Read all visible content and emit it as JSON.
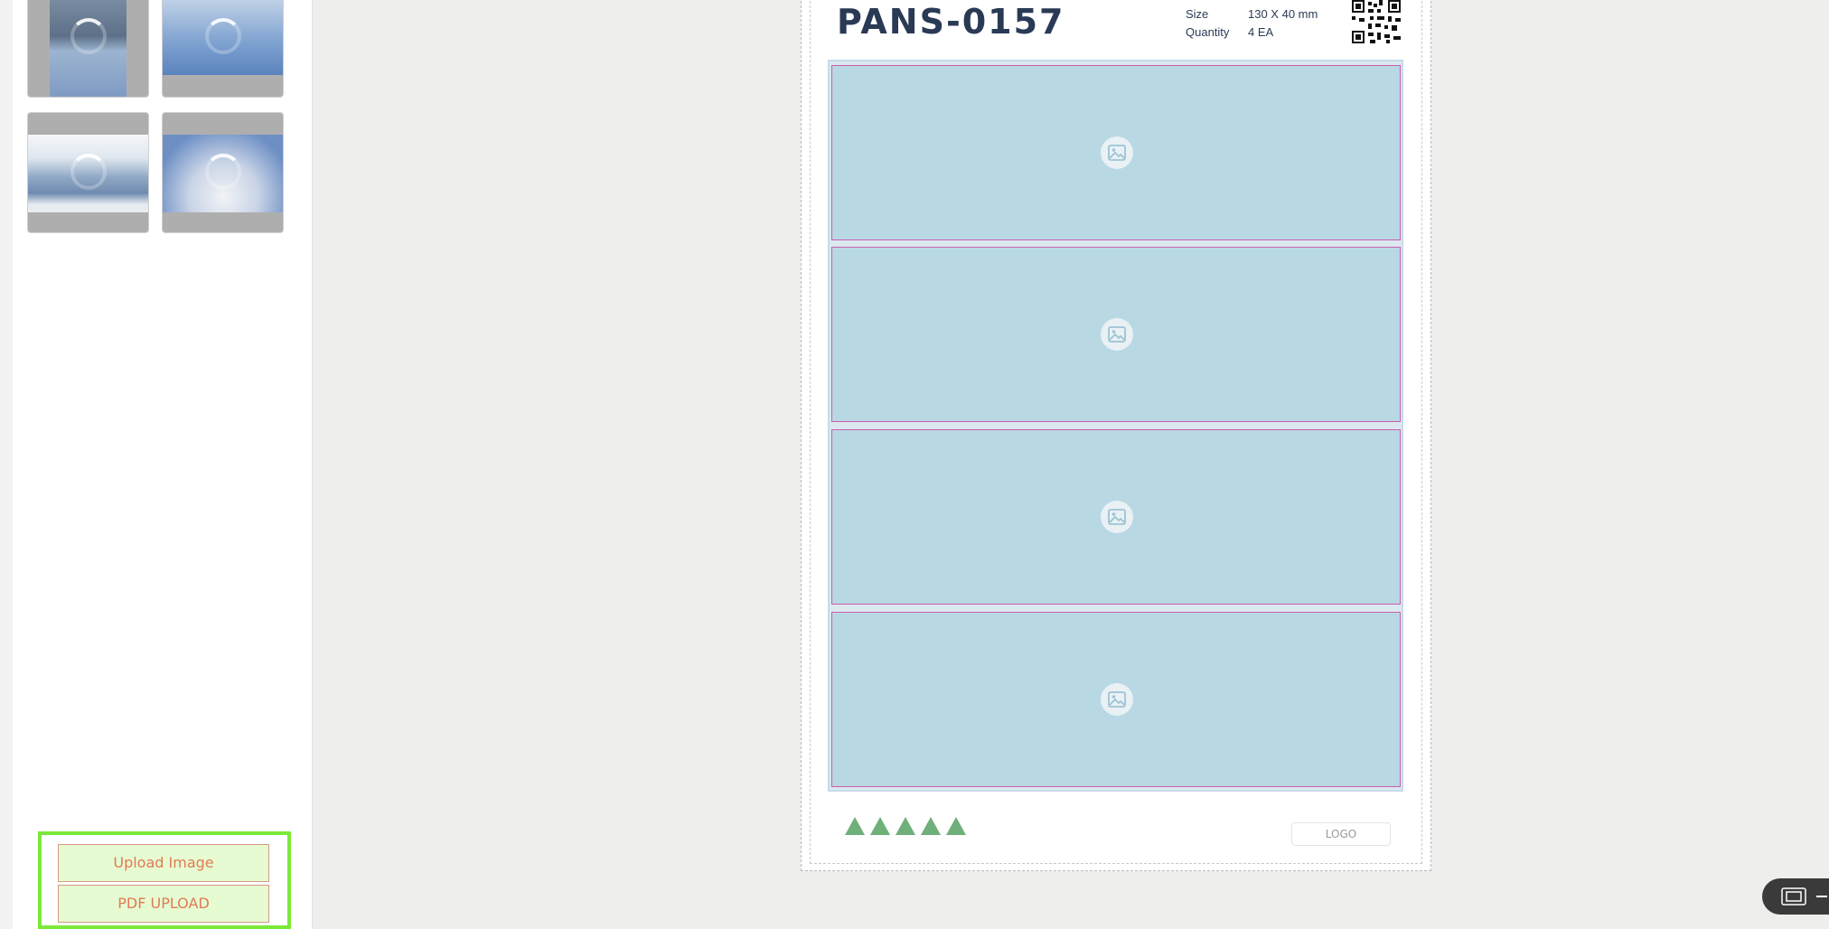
{
  "sidebar": {
    "thumbnails": [
      {
        "name": "sea-cliff-photo"
      },
      {
        "name": "airplane-sky-photo"
      },
      {
        "name": "santorini-photo"
      },
      {
        "name": "clouds-photo"
      }
    ],
    "upload_image_label": "Upload Image",
    "pdf_upload_label": "PDF UPLOAD"
  },
  "sheet": {
    "product_code": "PANS-0157",
    "size_label": "Size",
    "size_value": "130 X 40 mm",
    "quantity_label": "Quantity",
    "quantity_value": "4 EA",
    "slot_count": 4,
    "logo_label": "LOGO",
    "triangle_count": 5
  },
  "colors": {
    "upload_border": "#7be83a",
    "slot_fill": "#b8d8e4",
    "slot_border": "#cc5fae",
    "triangle": "#6fb07a",
    "title": "#2a3a55"
  }
}
